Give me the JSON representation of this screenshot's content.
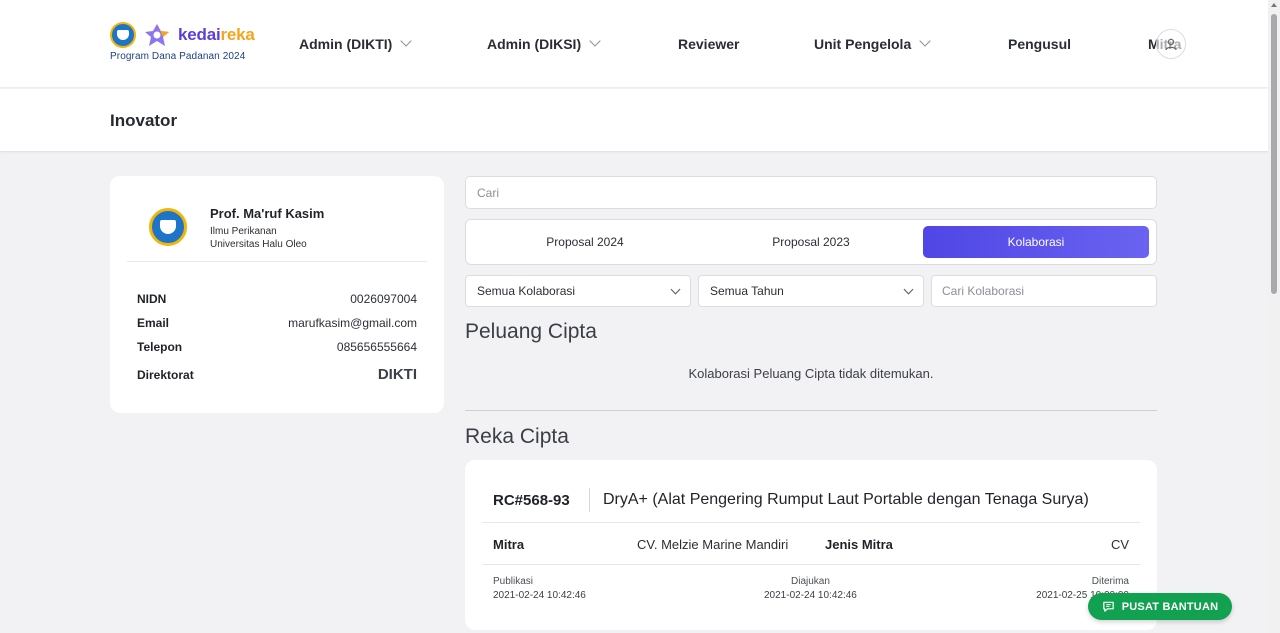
{
  "brand": {
    "name_part1": "kedai",
    "name_part2": "reka",
    "subtitle": "Program Dana Padanan 2024"
  },
  "nav": {
    "items": [
      {
        "label": "Admin (DIKTI)",
        "dropdown": true
      },
      {
        "label": "Admin (DIKSI)",
        "dropdown": true
      },
      {
        "label": "Reviewer",
        "dropdown": false
      },
      {
        "label": "Unit Pengelola",
        "dropdown": true
      },
      {
        "label": "Pengusul",
        "dropdown": false
      },
      {
        "label": "Mitra",
        "dropdown": false
      }
    ]
  },
  "page_title": "Inovator",
  "profile": {
    "name": "Prof. Ma'ruf Kasim",
    "department": "Ilmu Perikanan",
    "university": "Universitas Halu Oleo",
    "fields": [
      {
        "key": "NIDN",
        "value": "0026097004"
      },
      {
        "key": "Email",
        "value": "marufkasim@gmail.com"
      },
      {
        "key": "Telepon",
        "value": "085656555664"
      },
      {
        "key": "Direktorat",
        "value": "DIKTI"
      }
    ]
  },
  "search": {
    "placeholder": "Cari"
  },
  "tabs": [
    {
      "label": "Proposal 2024",
      "active": false
    },
    {
      "label": "Proposal 2023",
      "active": false
    },
    {
      "label": "Kolaborasi",
      "active": true
    }
  ],
  "filters": {
    "collaboration_select": "Semua Kolaborasi",
    "year_select": "Semua Tahun",
    "search_placeholder": "Cari Kolaborasi"
  },
  "sections": {
    "peluang": {
      "title": "Peluang Cipta",
      "empty_message": "Kolaborasi Peluang Cipta tidak ditemukan."
    },
    "reka": {
      "title": "Reka Cipta"
    }
  },
  "collaboration_card": {
    "code": "RC#568-93",
    "title": "DryA+ (Alat Pengering Rumput Laut Portable dengan Tenaga Surya)",
    "mitra_label": "Mitra",
    "mitra_value": "CV. Melzie Marine Mandiri",
    "jenis_label": "Jenis Mitra",
    "jenis_value": "CV",
    "dates": [
      {
        "label": "Publikasi",
        "value": "2021-02-24 10:42:46"
      },
      {
        "label": "Diajukan",
        "value": "2021-02-24 10:42:46"
      },
      {
        "label": "Diterima",
        "value": "2021-02-25 10:00:00"
      }
    ]
  },
  "help_button": {
    "label": "PUSAT BANTUAN"
  },
  "colors": {
    "accent": "#4f46e5",
    "help_green": "#12a150",
    "brand_purple": "#5b3fd6",
    "brand_orange": "#f4a51c"
  }
}
